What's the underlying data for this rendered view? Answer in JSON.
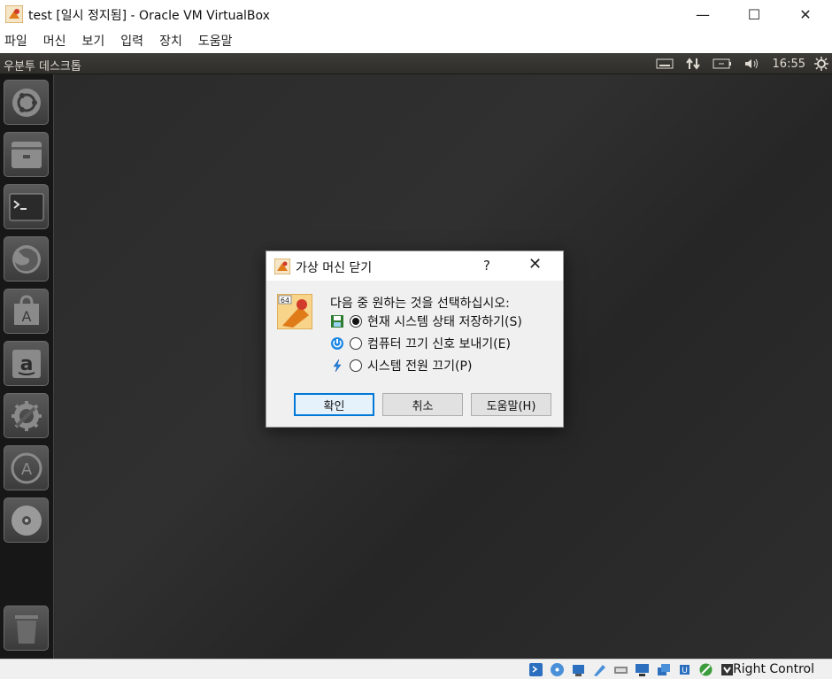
{
  "window": {
    "title": "test [일시 정지됨] - Oracle VM VirtualBox",
    "minimize": "—",
    "maximize": "☐",
    "close": "✕"
  },
  "menubar": {
    "items": [
      "파일",
      "머신",
      "보기",
      "입력",
      "장치",
      "도움말"
    ]
  },
  "guest": {
    "panel_title": "우분투 데스크톱",
    "clock": "16:55",
    "launcher_items": [
      "ubuntu-dash",
      "files",
      "terminal",
      "firefox",
      "app-store",
      "amazon",
      "system-settings",
      "software-updater",
      "dvd",
      "trash"
    ]
  },
  "dialog": {
    "title": "가상 머신 닫기",
    "help": "?",
    "close": "✕",
    "prompt": "다음 중 원하는 것을 선택하십시오:",
    "options": [
      {
        "label": "현재 시스템 상태 저장하기(S)",
        "selected": true
      },
      {
        "label": "컴퓨터 끄기 신호 보내기(E)",
        "selected": false
      },
      {
        "label": "시스템 전원 끄기(P)",
        "selected": false
      }
    ],
    "buttons": {
      "ok": "확인",
      "cancel": "취소",
      "help": "도움말(H)"
    }
  },
  "statusbar": {
    "host_key": "Right Control"
  }
}
